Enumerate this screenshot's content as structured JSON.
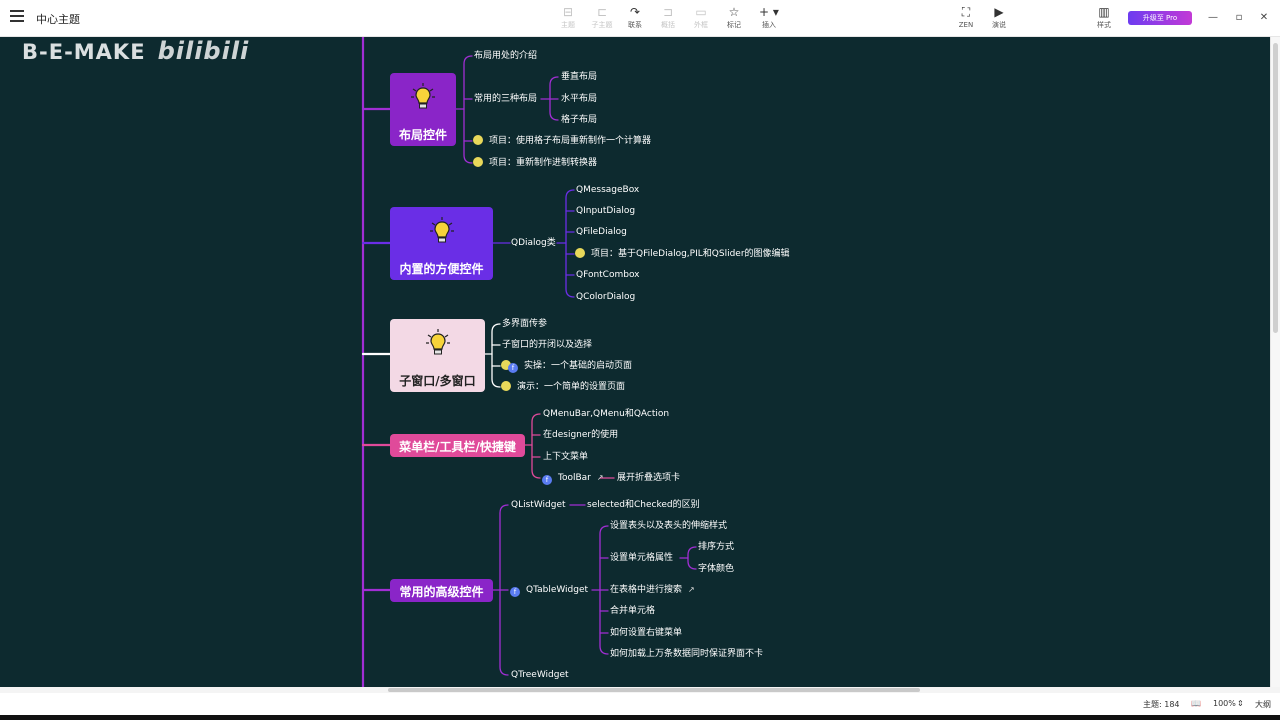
{
  "toolbar": {
    "doc_title": "中心主题",
    "tools": [
      {
        "label": "主题",
        "icon": "⊟"
      },
      {
        "label": "子主题",
        "icon": "⊏"
      },
      {
        "label": "联系",
        "icon": "↷"
      },
      {
        "label": "概括",
        "icon": "⊐"
      },
      {
        "label": "外框",
        "icon": "▭"
      },
      {
        "label": "标记",
        "icon": "☆"
      },
      {
        "label": "插入",
        "icon": "+ ▾"
      }
    ],
    "zen_label": "ZEN",
    "present_label": "演说",
    "zen_icon": "⛶",
    "present_icon": "▶",
    "style_label": "样式",
    "style_icon": "▥",
    "pro_label": "升级至 Pro",
    "win": {
      "min": "—",
      "max": "▫",
      "close": "✕"
    }
  },
  "watermark": {
    "text": "B-E-MAKE",
    "logo": "bilibili"
  },
  "topics": [
    {
      "label": "布局控件",
      "icon": "lightbulb-icon"
    },
    {
      "label": "内置的方便控件",
      "icon": "lightbulb-icon"
    },
    {
      "label": "子窗口/多窗口",
      "icon": "lightbulb-icon"
    },
    {
      "label": "菜单栏/工具栏/快捷键"
    },
    {
      "label": "常用的高级控件"
    }
  ],
  "nodes": {
    "layout_intro": "布局用处的介绍",
    "layout_three": "常用的三种布局",
    "layout_vertical": "垂直布局",
    "layout_horizontal": "水平布局",
    "layout_grid": "格子布局",
    "layout_proj1": "项目：使用格子布局重新制作一个计算器",
    "layout_proj2": "项目：重新制作进制转换器",
    "qdialog": "QDialog类",
    "qmessagebox": "QMessageBox",
    "qinputdialog": "QInputDialog",
    "qfiledialog": "QFileDialog",
    "qdialog_proj": "项目：基于QFileDialog,PIL和QSlider的图像编辑",
    "qfontcombox": "QFontCombox",
    "qcolordialog": "QColorDialog",
    "sub_param": "多界面传参",
    "sub_open": "子窗口的开闭以及选择",
    "sub_practice": "实操：一个基础的启动页面",
    "sub_demo": "演示：一个简单的设置页面",
    "menu_qmenubar": "QMenuBar,QMenu和QAction",
    "menu_designer": "在designer的使用",
    "menu_context": "上下文菜单",
    "menu_toolbar": "ToolBar",
    "menu_toolbar_child": "展开折叠选项卡",
    "adv_qlistwidget": "QListWidget",
    "adv_qlist_child": "selected和Checked的区别",
    "adv_qtablewidget": "QTableWidget",
    "tbl_header": "设置表头以及表头的伸缩样式",
    "tbl_cell": "设置单元格属性",
    "tbl_sort": "排序方式",
    "tbl_color": "字体颜色",
    "tbl_search": "在表格中进行搜索",
    "tbl_merge": "合并单元格",
    "tbl_rightmenu": "如何设置右键菜单",
    "tbl_bigdata": "如何加载上万条数据同时保证界面不卡",
    "adv_qtreewidget": "QTreeWidget"
  },
  "badges": {
    "yellow": "",
    "blue": "f"
  },
  "status": {
    "topic_count": "主题: 184",
    "zoom": "100%",
    "outline": "大纲",
    "book_icon": "📖",
    "zoom_stepper": "⇕"
  },
  "colors": {
    "canvas": "#0d2a2f",
    "trunk": "#a12ed4",
    "violet": "#6a2ee6",
    "pink": "#e04a9a",
    "purple": "#8a25c8"
  }
}
